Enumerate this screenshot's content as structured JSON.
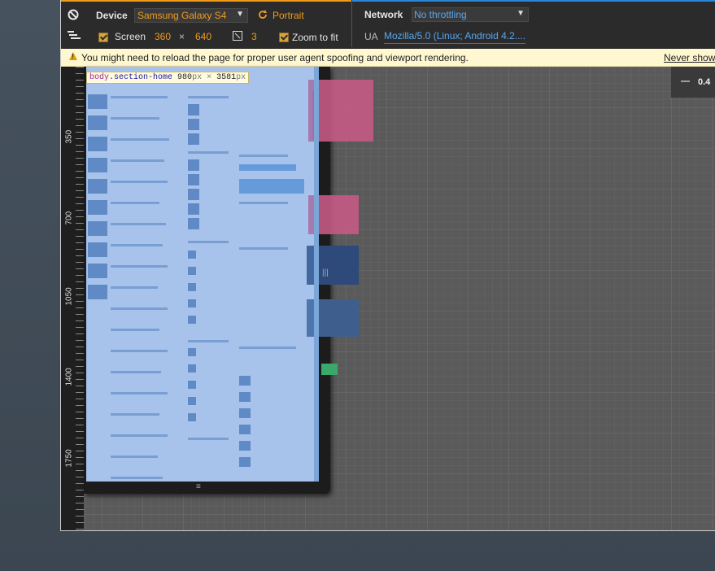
{
  "toolbar": {
    "device_label": "Device",
    "device_value": "Samsung Galaxy S4",
    "orientation_label": "Portrait",
    "screen_label": "Screen",
    "screen_width": "360",
    "screen_times": "×",
    "screen_height": "640",
    "dpr_value": "3",
    "zoom_label": "Zoom to fit",
    "network_label": "Network",
    "network_value": "No throttling",
    "ua_label": "UA",
    "ua_value": "Mozilla/5.0 (Linux; Android 4.2...."
  },
  "warning": {
    "message": "You might need to reload the page for proper user agent spoofing and viewport rendering.",
    "dismiss": "Never show"
  },
  "inspect_tooltip": {
    "tag": "body",
    "selector": ".section-home",
    "width": "980",
    "width_unit": "px",
    "times": "×",
    "height": "3581",
    "height_unit": "px"
  },
  "ruler": {
    "labels": [
      "350",
      "700",
      "1050",
      "1400",
      "1750"
    ]
  },
  "zoom_readout": "0.4",
  "colors": {
    "accent_orange": "#f29b1b",
    "accent_blue": "#58a6f0",
    "warning_bg": "#fff7d0"
  },
  "icons": {
    "emulation_toggle": "no-entry-icon",
    "media_queries": "media-query-bars-icon",
    "orientation": "rotate-icon",
    "dpr": "device-pixel-ratio-icon",
    "warning": "warning-triangle-icon"
  }
}
